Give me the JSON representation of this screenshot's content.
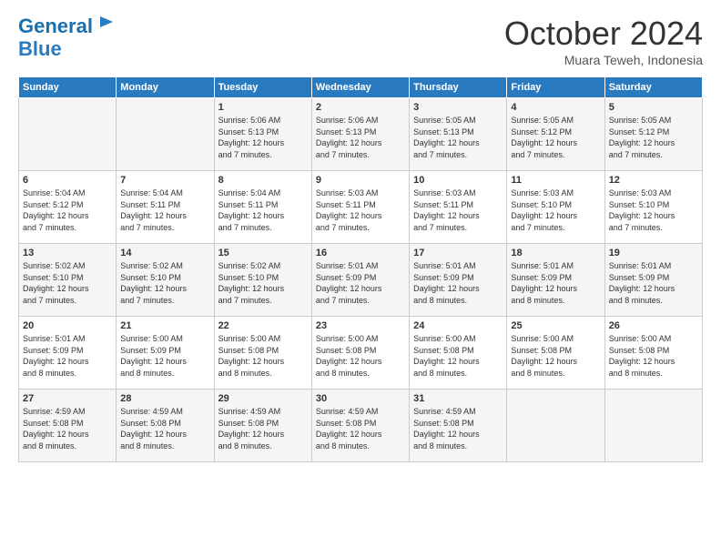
{
  "logo": {
    "line1": "General",
    "line2": "Blue"
  },
  "header": {
    "title": "October 2024",
    "subtitle": "Muara Teweh, Indonesia"
  },
  "columns": [
    "Sunday",
    "Monday",
    "Tuesday",
    "Wednesday",
    "Thursday",
    "Friday",
    "Saturday"
  ],
  "weeks": [
    {
      "days": [
        {
          "num": "",
          "info": ""
        },
        {
          "num": "",
          "info": ""
        },
        {
          "num": "1",
          "info": "Sunrise: 5:06 AM\nSunset: 5:13 PM\nDaylight: 12 hours\nand 7 minutes."
        },
        {
          "num": "2",
          "info": "Sunrise: 5:06 AM\nSunset: 5:13 PM\nDaylight: 12 hours\nand 7 minutes."
        },
        {
          "num": "3",
          "info": "Sunrise: 5:05 AM\nSunset: 5:13 PM\nDaylight: 12 hours\nand 7 minutes."
        },
        {
          "num": "4",
          "info": "Sunrise: 5:05 AM\nSunset: 5:12 PM\nDaylight: 12 hours\nand 7 minutes."
        },
        {
          "num": "5",
          "info": "Sunrise: 5:05 AM\nSunset: 5:12 PM\nDaylight: 12 hours\nand 7 minutes."
        }
      ]
    },
    {
      "days": [
        {
          "num": "6",
          "info": "Sunrise: 5:04 AM\nSunset: 5:12 PM\nDaylight: 12 hours\nand 7 minutes."
        },
        {
          "num": "7",
          "info": "Sunrise: 5:04 AM\nSunset: 5:11 PM\nDaylight: 12 hours\nand 7 minutes."
        },
        {
          "num": "8",
          "info": "Sunrise: 5:04 AM\nSunset: 5:11 PM\nDaylight: 12 hours\nand 7 minutes."
        },
        {
          "num": "9",
          "info": "Sunrise: 5:03 AM\nSunset: 5:11 PM\nDaylight: 12 hours\nand 7 minutes."
        },
        {
          "num": "10",
          "info": "Sunrise: 5:03 AM\nSunset: 5:11 PM\nDaylight: 12 hours\nand 7 minutes."
        },
        {
          "num": "11",
          "info": "Sunrise: 5:03 AM\nSunset: 5:10 PM\nDaylight: 12 hours\nand 7 minutes."
        },
        {
          "num": "12",
          "info": "Sunrise: 5:03 AM\nSunset: 5:10 PM\nDaylight: 12 hours\nand 7 minutes."
        }
      ]
    },
    {
      "days": [
        {
          "num": "13",
          "info": "Sunrise: 5:02 AM\nSunset: 5:10 PM\nDaylight: 12 hours\nand 7 minutes."
        },
        {
          "num": "14",
          "info": "Sunrise: 5:02 AM\nSunset: 5:10 PM\nDaylight: 12 hours\nand 7 minutes."
        },
        {
          "num": "15",
          "info": "Sunrise: 5:02 AM\nSunset: 5:10 PM\nDaylight: 12 hours\nand 7 minutes."
        },
        {
          "num": "16",
          "info": "Sunrise: 5:01 AM\nSunset: 5:09 PM\nDaylight: 12 hours\nand 7 minutes."
        },
        {
          "num": "17",
          "info": "Sunrise: 5:01 AM\nSunset: 5:09 PM\nDaylight: 12 hours\nand 8 minutes."
        },
        {
          "num": "18",
          "info": "Sunrise: 5:01 AM\nSunset: 5:09 PM\nDaylight: 12 hours\nand 8 minutes."
        },
        {
          "num": "19",
          "info": "Sunrise: 5:01 AM\nSunset: 5:09 PM\nDaylight: 12 hours\nand 8 minutes."
        }
      ]
    },
    {
      "days": [
        {
          "num": "20",
          "info": "Sunrise: 5:01 AM\nSunset: 5:09 PM\nDaylight: 12 hours\nand 8 minutes."
        },
        {
          "num": "21",
          "info": "Sunrise: 5:00 AM\nSunset: 5:09 PM\nDaylight: 12 hours\nand 8 minutes."
        },
        {
          "num": "22",
          "info": "Sunrise: 5:00 AM\nSunset: 5:08 PM\nDaylight: 12 hours\nand 8 minutes."
        },
        {
          "num": "23",
          "info": "Sunrise: 5:00 AM\nSunset: 5:08 PM\nDaylight: 12 hours\nand 8 minutes."
        },
        {
          "num": "24",
          "info": "Sunrise: 5:00 AM\nSunset: 5:08 PM\nDaylight: 12 hours\nand 8 minutes."
        },
        {
          "num": "25",
          "info": "Sunrise: 5:00 AM\nSunset: 5:08 PM\nDaylight: 12 hours\nand 8 minutes."
        },
        {
          "num": "26",
          "info": "Sunrise: 5:00 AM\nSunset: 5:08 PM\nDaylight: 12 hours\nand 8 minutes."
        }
      ]
    },
    {
      "days": [
        {
          "num": "27",
          "info": "Sunrise: 4:59 AM\nSunset: 5:08 PM\nDaylight: 12 hours\nand 8 minutes."
        },
        {
          "num": "28",
          "info": "Sunrise: 4:59 AM\nSunset: 5:08 PM\nDaylight: 12 hours\nand 8 minutes."
        },
        {
          "num": "29",
          "info": "Sunrise: 4:59 AM\nSunset: 5:08 PM\nDaylight: 12 hours\nand 8 minutes."
        },
        {
          "num": "30",
          "info": "Sunrise: 4:59 AM\nSunset: 5:08 PM\nDaylight: 12 hours\nand 8 minutes."
        },
        {
          "num": "31",
          "info": "Sunrise: 4:59 AM\nSunset: 5:08 PM\nDaylight: 12 hours\nand 8 minutes."
        },
        {
          "num": "",
          "info": ""
        },
        {
          "num": "",
          "info": ""
        }
      ]
    }
  ]
}
